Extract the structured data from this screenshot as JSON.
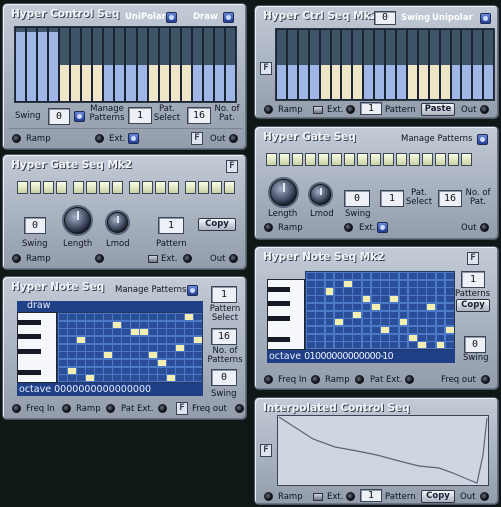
{
  "hyper_control_seq": {
    "title": "Hyper Control  Seq",
    "mode_label": "UniPolar",
    "draw_label": "Draw",
    "swing_label": "Swing",
    "swing_value": "0",
    "manage_patterns_label": "Manage Patterns",
    "pattern_value": "1",
    "pat_select_label": "Pat. Select",
    "num_patterns_value": "16",
    "num_patterns_label": "No. of Pat.",
    "ramp_label": "Ramp",
    "ext_label": "Ext.",
    "out_label": "Out",
    "badge": "F",
    "bar_levels": [
      0.95,
      0.95,
      0.95,
      0.95,
      0.5,
      0.5,
      0.5,
      0.5,
      0.5,
      0.5,
      0.5,
      0.5,
      0.5,
      0.5,
      0.5,
      0.5,
      0.5,
      0.5,
      0.5,
      0.5
    ]
  },
  "hyper_gate_seq_mk2": {
    "title": "Hyper Gate Seq Mk2",
    "swing_value": "0",
    "swing_label": "Swing",
    "length_label": "Length",
    "lmod_label": "Lmod",
    "pattern_value": "1",
    "pattern_label": "Pattern",
    "copy_label": "Copy",
    "ramp_label": "Ramp",
    "ext_label": "Ext.",
    "out_label": "Out",
    "badge": "F"
  },
  "hyper_note_seq": {
    "title": "Hyper Note Seq",
    "manage_patterns_label": "Manage Patterns",
    "draw_label": "draw",
    "pattern_value": "1",
    "pattern_select_label": "Pattern Select",
    "num_patterns_value": "16",
    "num_patterns_label": "No. of Patterns",
    "swing_value": "0",
    "swing_label": "Swing",
    "octave_label": "octave",
    "octave_values": "0 0 0 0 0 0 0 0 0 0 0 0 0 0 0 0",
    "freq_in_label": "Freq In",
    "ramp_label": "Ramp",
    "pat_ext_label": "Pat Ext.",
    "freq_out_label": "Freq out",
    "badge": "F"
  },
  "hyper_ctrl_seq_mk2": {
    "title": "Hyper Ctrl Seq Mk2",
    "value_box": "0",
    "swing_label": "Swing",
    "mode_label": "Unipolar",
    "ramp_label": "Ramp",
    "ext_label": "Ext.",
    "pattern_value": "1",
    "pattern_label": "Pattern",
    "paste_label": "Paste",
    "out_label": "Out",
    "badge": "F"
  },
  "hyper_gate_seq": {
    "title": "Hyper Gate Seq",
    "manage_patterns_label": "Manage Patterns",
    "length_label": "Length",
    "lmod_label": "Lmod",
    "swing_value": "0",
    "swing_label": "Swing",
    "pattern_value": "1",
    "pat_select_label": "Pat. Select",
    "num_patterns_value": "16",
    "num_patterns_label": "No. of Pat.",
    "ramp_label": "Ramp",
    "ext_label": "Ext.",
    "out_label": "Out"
  },
  "hyper_note_seq_mk2": {
    "title": "Hyper Note Seq Mk2",
    "pattern_value": "1",
    "patterns_label": "Patterns",
    "copy_label": "Copy",
    "swing_value": "0",
    "swing_label": "Swing",
    "octave_label": "octave",
    "octave_values": "0 1 0 0 0 0 0 0 0 0 0 0 0 0 -1 0",
    "freq_in_label": "Freq In",
    "ramp_label": "Ramp",
    "pat_ext_label": "Pat Ext.",
    "freq_out_label": "Freq out",
    "badge": "F"
  },
  "interpolated_control_seq": {
    "title": "Interpolated Control Seq",
    "ramp_label": "Ramp",
    "ext_label": "Ext.",
    "pattern_value": "1",
    "pattern_label": "Pattern",
    "copy_label": "Copy",
    "out_label": "Out",
    "badge": "F"
  },
  "colors": {
    "panel_top": "#c3cbd7",
    "grid_blue": "#4d79c9",
    "note_cell": "#f4efb0",
    "bar_blue": "#9fb6e6",
    "bar_cream": "#efe6c8"
  }
}
